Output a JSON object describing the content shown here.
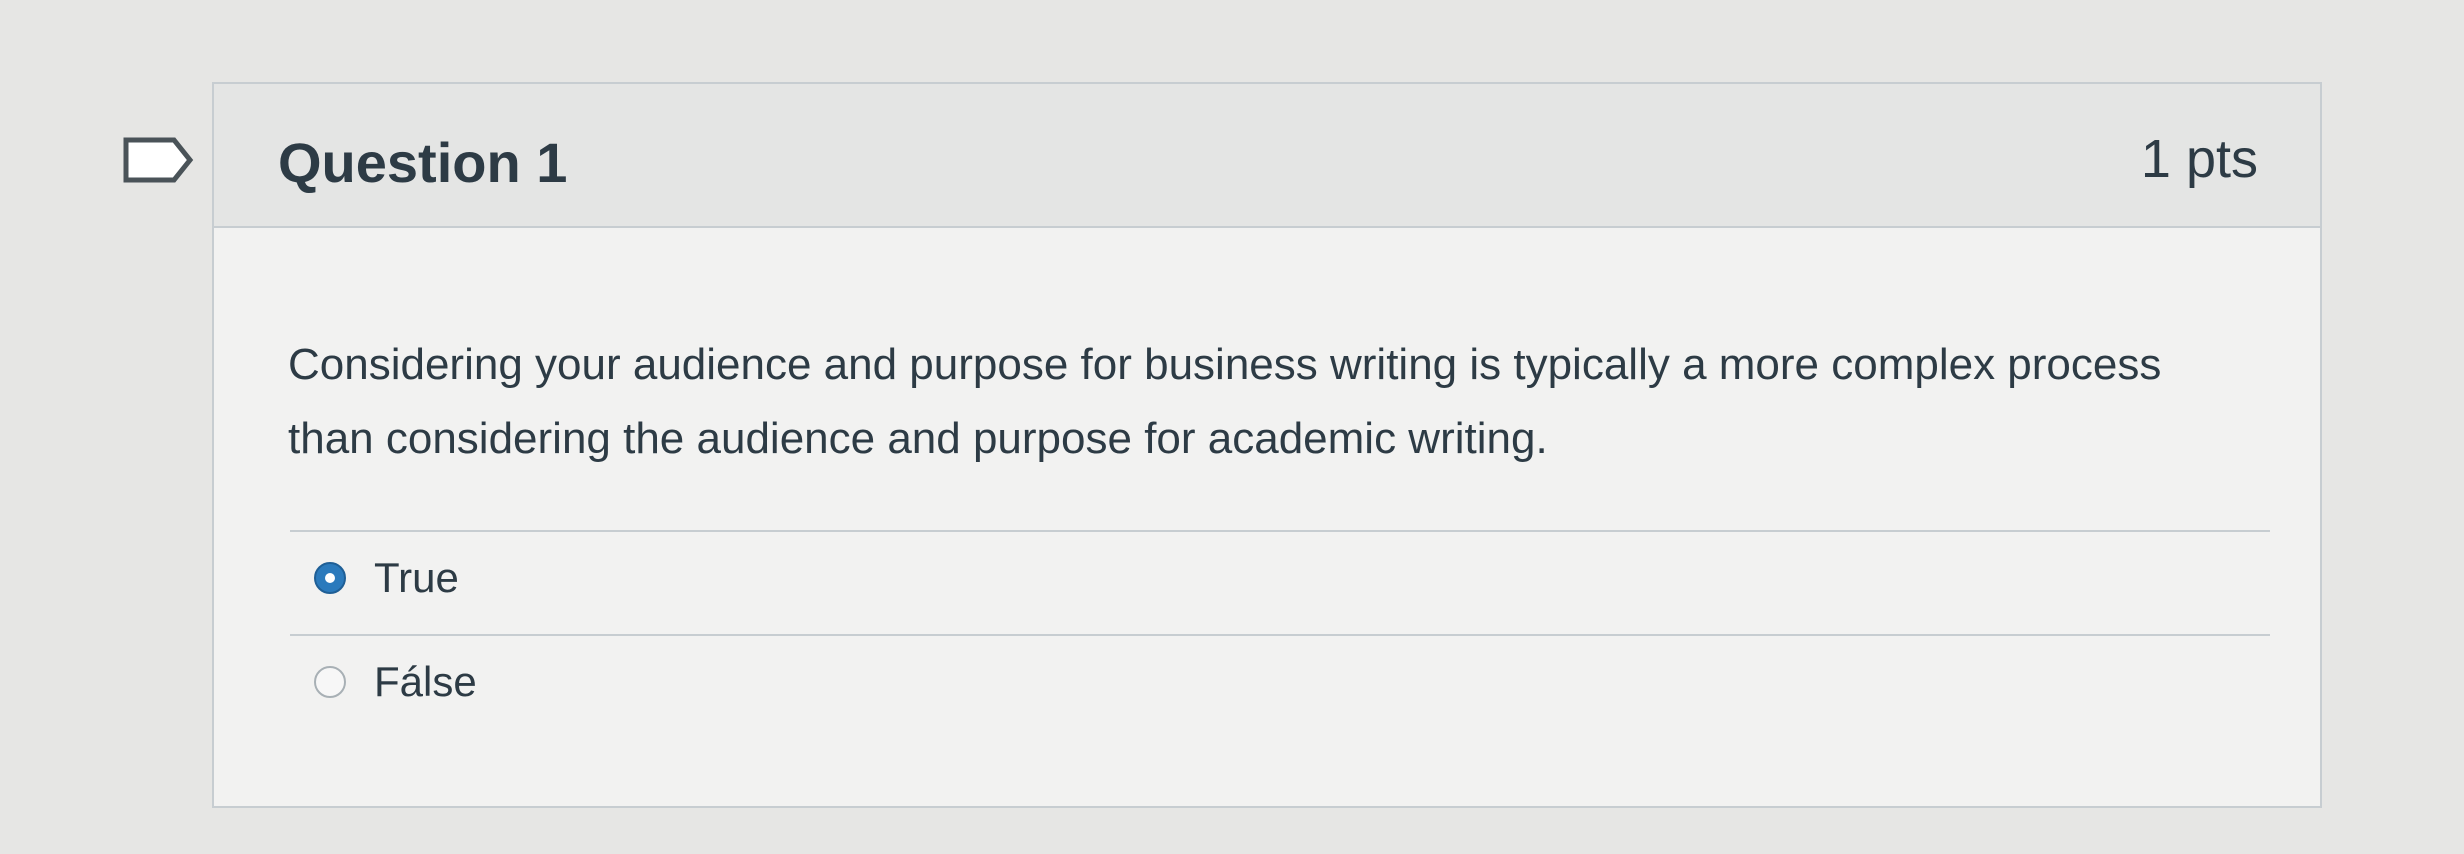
{
  "question": {
    "title": "Question 1",
    "points": "1 pts",
    "text": "Considering your audience and purpose for business writing is typically a more complex process than considering the audience and purpose for academic writing.",
    "flag_icon": "flag-outline-icon"
  },
  "answers": [
    {
      "label": "True",
      "selected": true
    },
    {
      "label": "Fálse",
      "selected": false
    }
  ],
  "colors": {
    "selected_radio": "#2b7abc",
    "text": "#2d3b45",
    "border": "#c7cdd1"
  }
}
